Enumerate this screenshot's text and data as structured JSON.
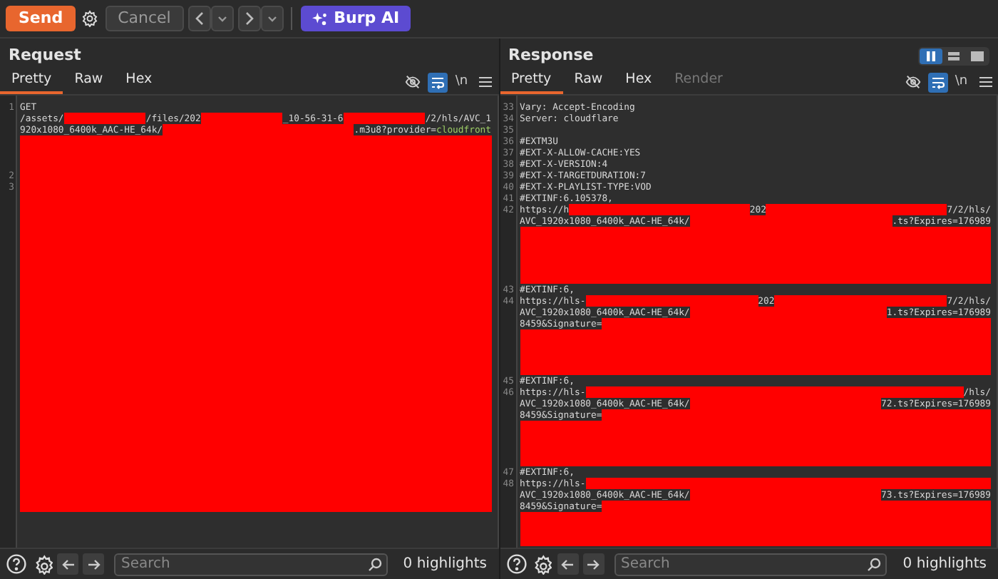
{
  "toolbar": {
    "send": "Send",
    "cancel": "Cancel",
    "ai": "Burp AI"
  },
  "panes": [
    {
      "title": "Request",
      "tabs": [
        {
          "label": "Pretty",
          "selected": true,
          "disabled": false
        },
        {
          "label": "Raw",
          "selected": false,
          "disabled": false
        },
        {
          "label": "Hex",
          "selected": false,
          "disabled": false
        }
      ],
      "view_options": [
        {
          "kind": "hide",
          "selected": false
        },
        {
          "kind": "wrap",
          "selected": true
        },
        {
          "kind": "newline",
          "label": "\\n",
          "selected": false
        },
        {
          "kind": "menu",
          "selected": false
        }
      ],
      "rows": [
        {
          "number": "1",
          "segments": [
            {
              "kind": "text",
              "text": "GET"
            }
          ]
        },
        {
          "segments": [
            {
              "kind": "text",
              "text": "/assets/"
            },
            {
              "kind": "redacted"
            },
            {
              "kind": "text",
              "text": "/files/202"
            },
            {
              "kind": "redacted"
            },
            {
              "kind": "text",
              "text": "_10-56-31-6"
            },
            {
              "kind": "redacted"
            },
            {
              "kind": "text",
              "text": "/2/hls/AVC_1"
            }
          ]
        },
        {
          "segments": [
            {
              "kind": "text",
              "text": "920x1080_6400k_AAC-HE_64k/"
            },
            {
              "kind": "redacted"
            },
            {
              "kind": "text",
              "text": ".m3u8?provider="
            },
            {
              "kind": "value",
              "text": "cloudfront"
            }
          ]
        },
        {
          "segments": [
            {
              "kind": "redacted"
            }
          ]
        },
        {
          "segments": [
            {
              "kind": "redacted"
            }
          ]
        },
        {
          "segments": [
            {
              "kind": "redacted"
            }
          ]
        },
        {
          "number": "2",
          "segments": [
            {
              "kind": "redacted"
            }
          ]
        },
        {
          "number": "3",
          "segments": [
            {
              "kind": "redacted"
            }
          ]
        },
        {
          "segments": [
            {
              "kind": "redacted"
            }
          ]
        },
        {
          "segments": [
            {
              "kind": "redacted"
            }
          ]
        },
        {
          "segments": [
            {
              "kind": "redacted"
            }
          ]
        },
        {
          "segments": [
            {
              "kind": "redacted"
            }
          ]
        },
        {
          "segments": [
            {
              "kind": "redacted"
            }
          ]
        },
        {
          "segments": [
            {
              "kind": "redacted"
            }
          ]
        },
        {
          "segments": [
            {
              "kind": "redacted"
            }
          ]
        },
        {
          "segments": [
            {
              "kind": "redacted"
            }
          ]
        },
        {
          "segments": [
            {
              "kind": "redacted"
            }
          ]
        },
        {
          "segments": [
            {
              "kind": "redacted"
            }
          ]
        },
        {
          "segments": [
            {
              "kind": "redacted"
            }
          ]
        },
        {
          "segments": [
            {
              "kind": "redacted"
            }
          ]
        },
        {
          "segments": [
            {
              "kind": "redacted"
            }
          ]
        },
        {
          "segments": [
            {
              "kind": "redacted"
            }
          ]
        },
        {
          "segments": [
            {
              "kind": "redacted"
            }
          ]
        },
        {
          "segments": [
            {
              "kind": "redacted"
            }
          ]
        },
        {
          "segments": [
            {
              "kind": "redacted"
            }
          ]
        },
        {
          "segments": [
            {
              "kind": "redacted"
            }
          ]
        },
        {
          "segments": [
            {
              "kind": "redacted"
            }
          ]
        },
        {
          "segments": [
            {
              "kind": "redacted"
            }
          ]
        },
        {
          "segments": [
            {
              "kind": "redacted"
            }
          ]
        },
        {
          "segments": [
            {
              "kind": "redacted"
            }
          ]
        },
        {
          "segments": [
            {
              "kind": "redacted"
            }
          ]
        },
        {
          "segments": [
            {
              "kind": "redacted"
            }
          ]
        },
        {
          "segments": [
            {
              "kind": "redacted"
            }
          ]
        },
        {
          "segments": [
            {
              "kind": "redacted"
            }
          ]
        },
        {
          "segments": [
            {
              "kind": "redacted"
            }
          ]
        },
        {
          "segments": [
            {
              "kind": "redacted"
            }
          ]
        }
      ],
      "search": {
        "placeholder": "Search"
      },
      "highlights": "0 highlights"
    },
    {
      "title": "Response",
      "layouts": [
        {
          "kind": "columns",
          "selected": true
        },
        {
          "kind": "rows",
          "selected": false
        },
        {
          "kind": "single",
          "selected": false
        }
      ],
      "tabs": [
        {
          "label": "Pretty",
          "selected": true,
          "disabled": false
        },
        {
          "label": "Raw",
          "selected": false,
          "disabled": false
        },
        {
          "label": "Hex",
          "selected": false,
          "disabled": false
        },
        {
          "label": "Render",
          "selected": false,
          "disabled": true
        }
      ],
      "view_options": [
        {
          "kind": "hide",
          "selected": false
        },
        {
          "kind": "wrap",
          "selected": true
        },
        {
          "kind": "newline",
          "label": "\\n",
          "selected": false
        },
        {
          "kind": "menu",
          "selected": false
        }
      ],
      "rows": [
        {
          "number": "33",
          "segments": [
            {
              "kind": "text",
              "text": "Vary: Accept-Encoding"
            }
          ]
        },
        {
          "number": "34",
          "segments": [
            {
              "kind": "text",
              "text": "Server: cloudflare"
            }
          ]
        },
        {
          "number": "35",
          "segments": []
        },
        {
          "number": "36",
          "segments": [
            {
              "kind": "text",
              "text": "#EXTM3U"
            }
          ]
        },
        {
          "number": "37",
          "segments": [
            {
              "kind": "text",
              "text": "#EXT-X-ALLOW-CACHE:YES"
            }
          ]
        },
        {
          "number": "38",
          "segments": [
            {
              "kind": "text",
              "text": "#EXT-X-VERSION:4"
            }
          ]
        },
        {
          "number": "39",
          "segments": [
            {
              "kind": "text",
              "text": "#EXT-X-TARGETDURATION:7"
            }
          ]
        },
        {
          "number": "40",
          "segments": [
            {
              "kind": "text",
              "text": "#EXT-X-PLAYLIST-TYPE:VOD"
            }
          ]
        },
        {
          "number": "41",
          "segments": [
            {
              "kind": "text",
              "text": "#EXTINF:6.105378,"
            }
          ]
        },
        {
          "number": "42",
          "segments": [
            {
              "kind": "text",
              "text": "https://h"
            },
            {
              "kind": "redacted"
            },
            {
              "kind": "text",
              "text": "202"
            },
            {
              "kind": "redacted"
            },
            {
              "kind": "text",
              "text": "7/2/hls/"
            }
          ]
        },
        {
          "segments": [
            {
              "kind": "text",
              "text": "AVC_1920x1080_6400k_AAC-HE_64k/"
            },
            {
              "kind": "redacted"
            },
            {
              "kind": "text",
              "text": ".ts?Expires=176989"
            }
          ]
        },
        {
          "segments": [
            {
              "kind": "redacted"
            }
          ]
        },
        {
          "segments": [
            {
              "kind": "redacted"
            }
          ]
        },
        {
          "segments": [
            {
              "kind": "redacted"
            }
          ]
        },
        {
          "segments": [
            {
              "kind": "redacted"
            }
          ]
        },
        {
          "segments": [
            {
              "kind": "redacted"
            }
          ]
        },
        {
          "number": "43",
          "segments": [
            {
              "kind": "text",
              "text": "#EXTINF:6,"
            }
          ]
        },
        {
          "number": "44",
          "segments": [
            {
              "kind": "text",
              "text": "https://hls-"
            },
            {
              "kind": "redacted"
            },
            {
              "kind": "text",
              "text": "202"
            },
            {
              "kind": "redacted"
            },
            {
              "kind": "text",
              "text": "7/2/hls/"
            }
          ]
        },
        {
          "segments": [
            {
              "kind": "text",
              "text": "AVC_1920x1080_6400k_AAC-HE_64k/"
            },
            {
              "kind": "redacted"
            },
            {
              "kind": "text",
              "text": "1.ts?Expires=176989"
            }
          ]
        },
        {
          "segments": [
            {
              "kind": "text",
              "text": "8459&Signature="
            },
            {
              "kind": "redacted"
            }
          ]
        },
        {
          "segments": [
            {
              "kind": "redacted"
            }
          ]
        },
        {
          "segments": [
            {
              "kind": "redacted"
            }
          ]
        },
        {
          "segments": [
            {
              "kind": "redacted"
            }
          ]
        },
        {
          "segments": [
            {
              "kind": "redacted"
            }
          ]
        },
        {
          "number": "45",
          "segments": [
            {
              "kind": "text",
              "text": "#EXTINF:6,"
            }
          ]
        },
        {
          "number": "46",
          "segments": [
            {
              "kind": "text",
              "text": "https://hls-"
            },
            {
              "kind": "redacted"
            },
            {
              "kind": "text",
              "text": "/hls/"
            }
          ]
        },
        {
          "segments": [
            {
              "kind": "text",
              "text": "AVC_1920x1080_6400k_AAC-HE_64k/"
            },
            {
              "kind": "redacted"
            },
            {
              "kind": "text",
              "text": "72.ts?Expires=176989"
            }
          ]
        },
        {
          "segments": [
            {
              "kind": "text",
              "text": "8459&Signature="
            },
            {
              "kind": "redacted"
            }
          ]
        },
        {
          "segments": [
            {
              "kind": "redacted"
            }
          ]
        },
        {
          "segments": [
            {
              "kind": "redacted"
            }
          ]
        },
        {
          "segments": [
            {
              "kind": "redacted"
            }
          ]
        },
        {
          "segments": [
            {
              "kind": "redacted"
            }
          ]
        },
        {
          "number": "47",
          "segments": [
            {
              "kind": "text",
              "text": "#EXTINF:6,"
            }
          ]
        },
        {
          "number": "48",
          "segments": [
            {
              "kind": "text",
              "text": "https://hls-"
            },
            {
              "kind": "redacted"
            }
          ]
        },
        {
          "segments": [
            {
              "kind": "text",
              "text": "AVC_1920x1080_6400k_AAC-HE_64k/"
            },
            {
              "kind": "redacted"
            },
            {
              "kind": "text",
              "text": "73.ts?Expires=176989"
            }
          ]
        },
        {
          "segments": [
            {
              "kind": "text",
              "text": "8459&Signature="
            },
            {
              "kind": "redacted"
            }
          ]
        },
        {
          "segments": [
            {
              "kind": "redacted"
            }
          ]
        },
        {
          "segments": [
            {
              "kind": "redacted"
            }
          ]
        },
        {
          "segments": [
            {
              "kind": "redacted"
            }
          ]
        }
      ],
      "search": {
        "placeholder": "Search"
      },
      "highlights": "0 highlights"
    }
  ]
}
